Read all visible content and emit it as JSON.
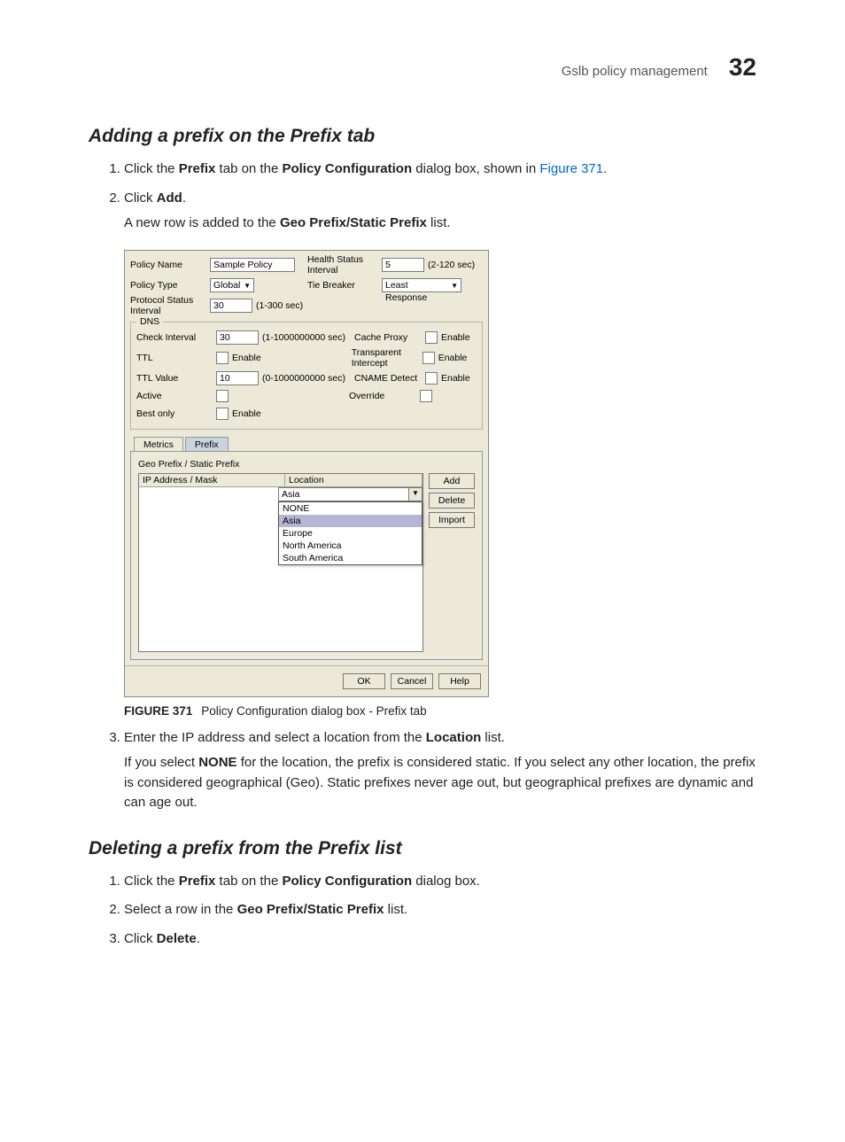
{
  "header": {
    "title": "Gslb policy management",
    "number": "32"
  },
  "section1": {
    "title": "Adding a prefix on the Prefix tab",
    "step1_a": "Click the ",
    "step1_b": "Prefix",
    "step1_c": " tab on the ",
    "step1_d": "Policy Configuration",
    "step1_e": " dialog box, shown in ",
    "step1_link": "Figure 371",
    "step1_f": ".",
    "step2_a": "Click ",
    "step2_b": "Add",
    "step2_c": ".",
    "step2_sub_a": "A new row is added to the ",
    "step2_sub_b": "Geo Prefix/Static Prefix",
    "step2_sub_c": " list.",
    "step3_a": "Enter the IP address and select a location from the ",
    "step3_b": "Location",
    "step3_c": " list.",
    "step3_sub_a": "If you select ",
    "step3_sub_b": "NONE",
    "step3_sub_c": " for the location, the prefix is considered static. If you select any other location, the prefix is considered geographical (Geo). Static prefixes never age out, but geographical prefixes are dynamic and can age out."
  },
  "figure": {
    "num": "FIGURE 371",
    "caption": "Policy Configuration dialog box - Prefix tab"
  },
  "section2": {
    "title": "Deleting a prefix from the Prefix list",
    "step1_a": "Click the ",
    "step1_b": "Prefix",
    "step1_c": " tab on the ",
    "step1_d": "Policy Configuration",
    "step1_e": " dialog box.",
    "step2_a": "Select a row in the ",
    "step2_b": "Geo Prefix/Static Prefix",
    "step2_c": " list.",
    "step3_a": "Click ",
    "step3_b": "Delete",
    "step3_c": "."
  },
  "dialog": {
    "row1": {
      "policyName": "Policy Name",
      "policyNameVal": "Sample Policy",
      "hsi": "Health Status Interval",
      "hsiVal": "5",
      "hsiUnit": "(2-120 sec)"
    },
    "row2": {
      "policyType": "Policy Type",
      "policyTypeVal": "Global",
      "tieBreaker": "Tie Breaker",
      "tieBreakerVal": "Least Response"
    },
    "row3": {
      "psi": "Protocol Status Interval",
      "psiVal": "30",
      "psiUnit": "(1-300 sec)"
    },
    "dns": {
      "legend": "DNS",
      "checkInterval": "Check Interval",
      "checkIntervalVal": "30",
      "checkIntervalUnit": "(1-1000000000 sec)",
      "cacheProxy": "Cache Proxy",
      "enable": "Enable",
      "ttl": "TTL",
      "transIntercept": "Transparent Intercept",
      "ttlValue": "TTL Value",
      "ttlValueVal": "10",
      "ttlValueUnit": "(0-1000000000 sec)",
      "cnameDetect": "CNAME Detect",
      "active": "Active",
      "override": "Override",
      "bestOnly": "Best only"
    },
    "tabs": {
      "metrics": "Metrics",
      "prefix": "Prefix"
    },
    "prefixPanel": {
      "title": "Geo Prefix / Static Prefix",
      "colIp": "IP Address / Mask",
      "colLoc": "Location",
      "locVal": "Asia",
      "options": [
        "NONE",
        "Asia",
        "Europe",
        "North America",
        "South America"
      ],
      "selectedIdx": 1,
      "btnAdd": "Add",
      "btnDelete": "Delete",
      "btnImport": "Import"
    },
    "footer": {
      "ok": "OK",
      "cancel": "Cancel",
      "help": "Help"
    }
  }
}
